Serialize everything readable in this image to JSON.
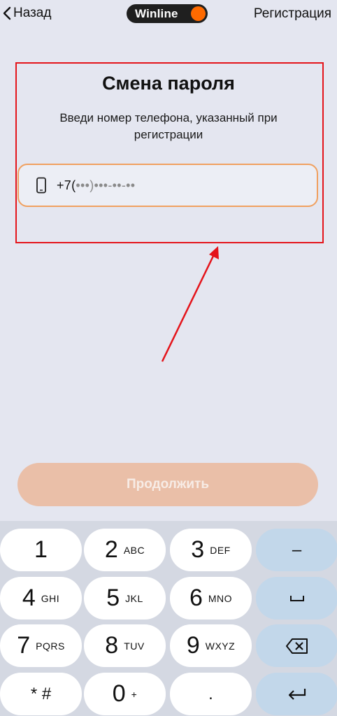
{
  "header": {
    "back_label": "Назад",
    "logo_text": "Winline",
    "register_label": "Регистрация"
  },
  "form": {
    "title": "Смена пароля",
    "subtitle": "Введи номер телефона, указанный при регистрации",
    "phone": {
      "prefix": "+7(",
      "mask": "•••)•••-••-••",
      "icon": "smartphone-icon"
    }
  },
  "continue_label": "Продолжить",
  "keypad": {
    "keys": [
      {
        "num": "1",
        "letters": ""
      },
      {
        "num": "2",
        "letters": "ABC"
      },
      {
        "num": "3",
        "letters": "DEF"
      },
      {
        "sym": "–"
      },
      {
        "num": "4",
        "letters": "GHI"
      },
      {
        "num": "5",
        "letters": "JKL"
      },
      {
        "num": "6",
        "letters": "MNO"
      },
      {
        "sym": "␣"
      },
      {
        "num": "7",
        "letters": "PQRS"
      },
      {
        "num": "8",
        "letters": "TUV"
      },
      {
        "num": "9",
        "letters": "WXYZ"
      },
      {
        "icon": "backspace-icon"
      },
      {
        "sym": "* #"
      },
      {
        "num": "0",
        "letters": "+"
      },
      {
        "sym": "."
      },
      {
        "icon": "return-icon"
      }
    ]
  },
  "colors": {
    "accent_orange": "#ff6a00",
    "annotation_red": "#e4141b",
    "button_disabled": "#eabfa8"
  }
}
